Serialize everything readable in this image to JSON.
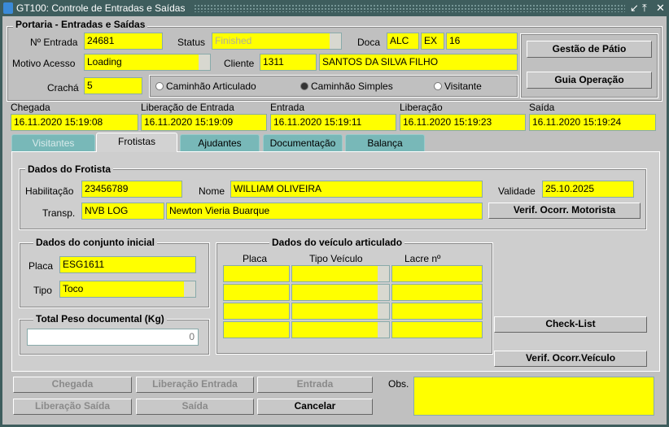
{
  "window": {
    "title": "GT100: Controle de Entradas e Saídas",
    "buttons": [
      "↙",
      "⤒",
      "✕"
    ]
  },
  "portaria": {
    "legend": "Portaria - Entradas e Saídas",
    "n_entrada_label": "Nº Entrada",
    "n_entrada": "24681",
    "status_label": "Status",
    "status": "Finished",
    "doca_label": "Doca",
    "doca": [
      "ALC",
      "EX",
      "16"
    ],
    "motivo_label": "Motivo Acesso",
    "motivo": "Loading",
    "cliente_label": "Cliente",
    "cliente_code": "1311",
    "cliente_name": "SANTOS DA SILVA FILHO",
    "cracha_label": "Crachá",
    "cracha": "5",
    "radios": [
      {
        "label": "Caminhão Articulado",
        "checked": false
      },
      {
        "label": "Caminhão Simples",
        "checked": true
      },
      {
        "label": "Visitante",
        "checked": false
      }
    ],
    "btn_gestao": "Gestão de Pátio",
    "btn_guia": "Guia Operação"
  },
  "times": [
    {
      "label": "Chegada",
      "value": "16.11.2020 15:19:08"
    },
    {
      "label": "Liberação de Entrada",
      "value": "16.11.2020 15:19:09"
    },
    {
      "label": "Entrada",
      "value": "16.11.2020 15:19:11"
    },
    {
      "label": "Liberação",
      "value": "16.11.2020 15:19:23"
    },
    {
      "label": "Saída",
      "value": "16.11.2020 15:19:24"
    }
  ],
  "tabs": [
    "Visitantes",
    "Frotistas",
    "Ajudantes",
    "Documentação",
    "Balança"
  ],
  "frotista": {
    "legend": "Dados do Frotista",
    "habilitacao_label": "Habilitação",
    "habilitacao": "23456789",
    "nome_label": "Nome",
    "nome": "WILLIAM OLIVEIRA",
    "validade_label": "Validade",
    "validade": "25.10.2025",
    "transp_label": "Transp.",
    "transp_code": "NVB LOG",
    "transp_name": "Newton Vieria Buarque",
    "btn_verif": "Verif. Ocorr. Motorista"
  },
  "conjunto": {
    "legend": "Dados do conjunto inicial",
    "placa_label": "Placa",
    "placa": "ESG1611",
    "tipo_label": "Tipo",
    "tipo": "Toco"
  },
  "peso": {
    "legend": "Total Peso documental (Kg)",
    "value": "0"
  },
  "articulado": {
    "legend": "Dados do veículo articulado",
    "headers": [
      "Placa",
      "Tipo Veículo",
      "Lacre nº"
    ]
  },
  "btn_checklist": "Check-List",
  "btn_verif_veiculo": "Verif. Ocorr.Veículo",
  "footer": {
    "chegada": "Chegada",
    "lib_entrada": "Liberação Entrada",
    "entrada": "Entrada",
    "lib_saida": "Liberação Saída",
    "saida": "Saída",
    "cancelar": "Cancelar",
    "obs_label": "Obs."
  }
}
